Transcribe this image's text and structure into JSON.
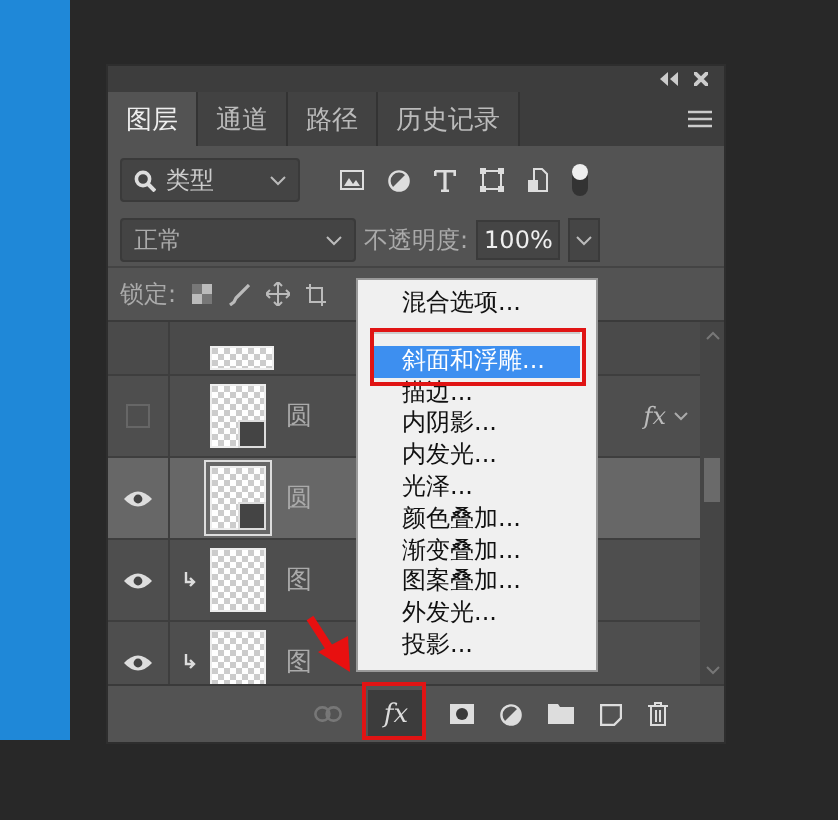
{
  "panel": {
    "tabs": [
      {
        "label": "图层",
        "selected": true
      },
      {
        "label": "通道",
        "selected": false
      },
      {
        "label": "路径",
        "selected": false
      },
      {
        "label": "历史记录",
        "selected": false
      }
    ],
    "filter": {
      "value": "类型",
      "toggle_on": true
    },
    "blend_mode": {
      "value": "正常"
    },
    "opacity": {
      "label": "不透明度:",
      "value": "100%"
    },
    "lock": {
      "label": "锁定:"
    },
    "layers": [
      {
        "name": "圆",
        "visible": false,
        "selected": false,
        "clipped": false,
        "effects_badge": "fx"
      },
      {
        "name": "圆",
        "visible": true,
        "selected": true,
        "clipped": false
      },
      {
        "name": "图",
        "visible": true,
        "selected": false,
        "clipped": true
      },
      {
        "name": "图",
        "visible": true,
        "selected": false,
        "clipped": true
      }
    ],
    "footer": {
      "fx_button": "fx"
    },
    "context_menu": {
      "items": [
        {
          "label": "混合选项...",
          "selected": false,
          "divider_after": true
        },
        {
          "label": "斜面和浮雕...",
          "selected": true
        },
        {
          "label": "描边...",
          "selected": false
        },
        {
          "label": "内阴影...",
          "selected": false
        },
        {
          "label": "内发光...",
          "selected": false
        },
        {
          "label": "光泽...",
          "selected": false
        },
        {
          "label": "颜色叠加...",
          "selected": false
        },
        {
          "label": "渐变叠加...",
          "selected": false
        },
        {
          "label": "图案叠加...",
          "selected": false
        },
        {
          "label": "外发光...",
          "selected": false
        },
        {
          "label": "投影...",
          "selected": false
        }
      ]
    }
  }
}
